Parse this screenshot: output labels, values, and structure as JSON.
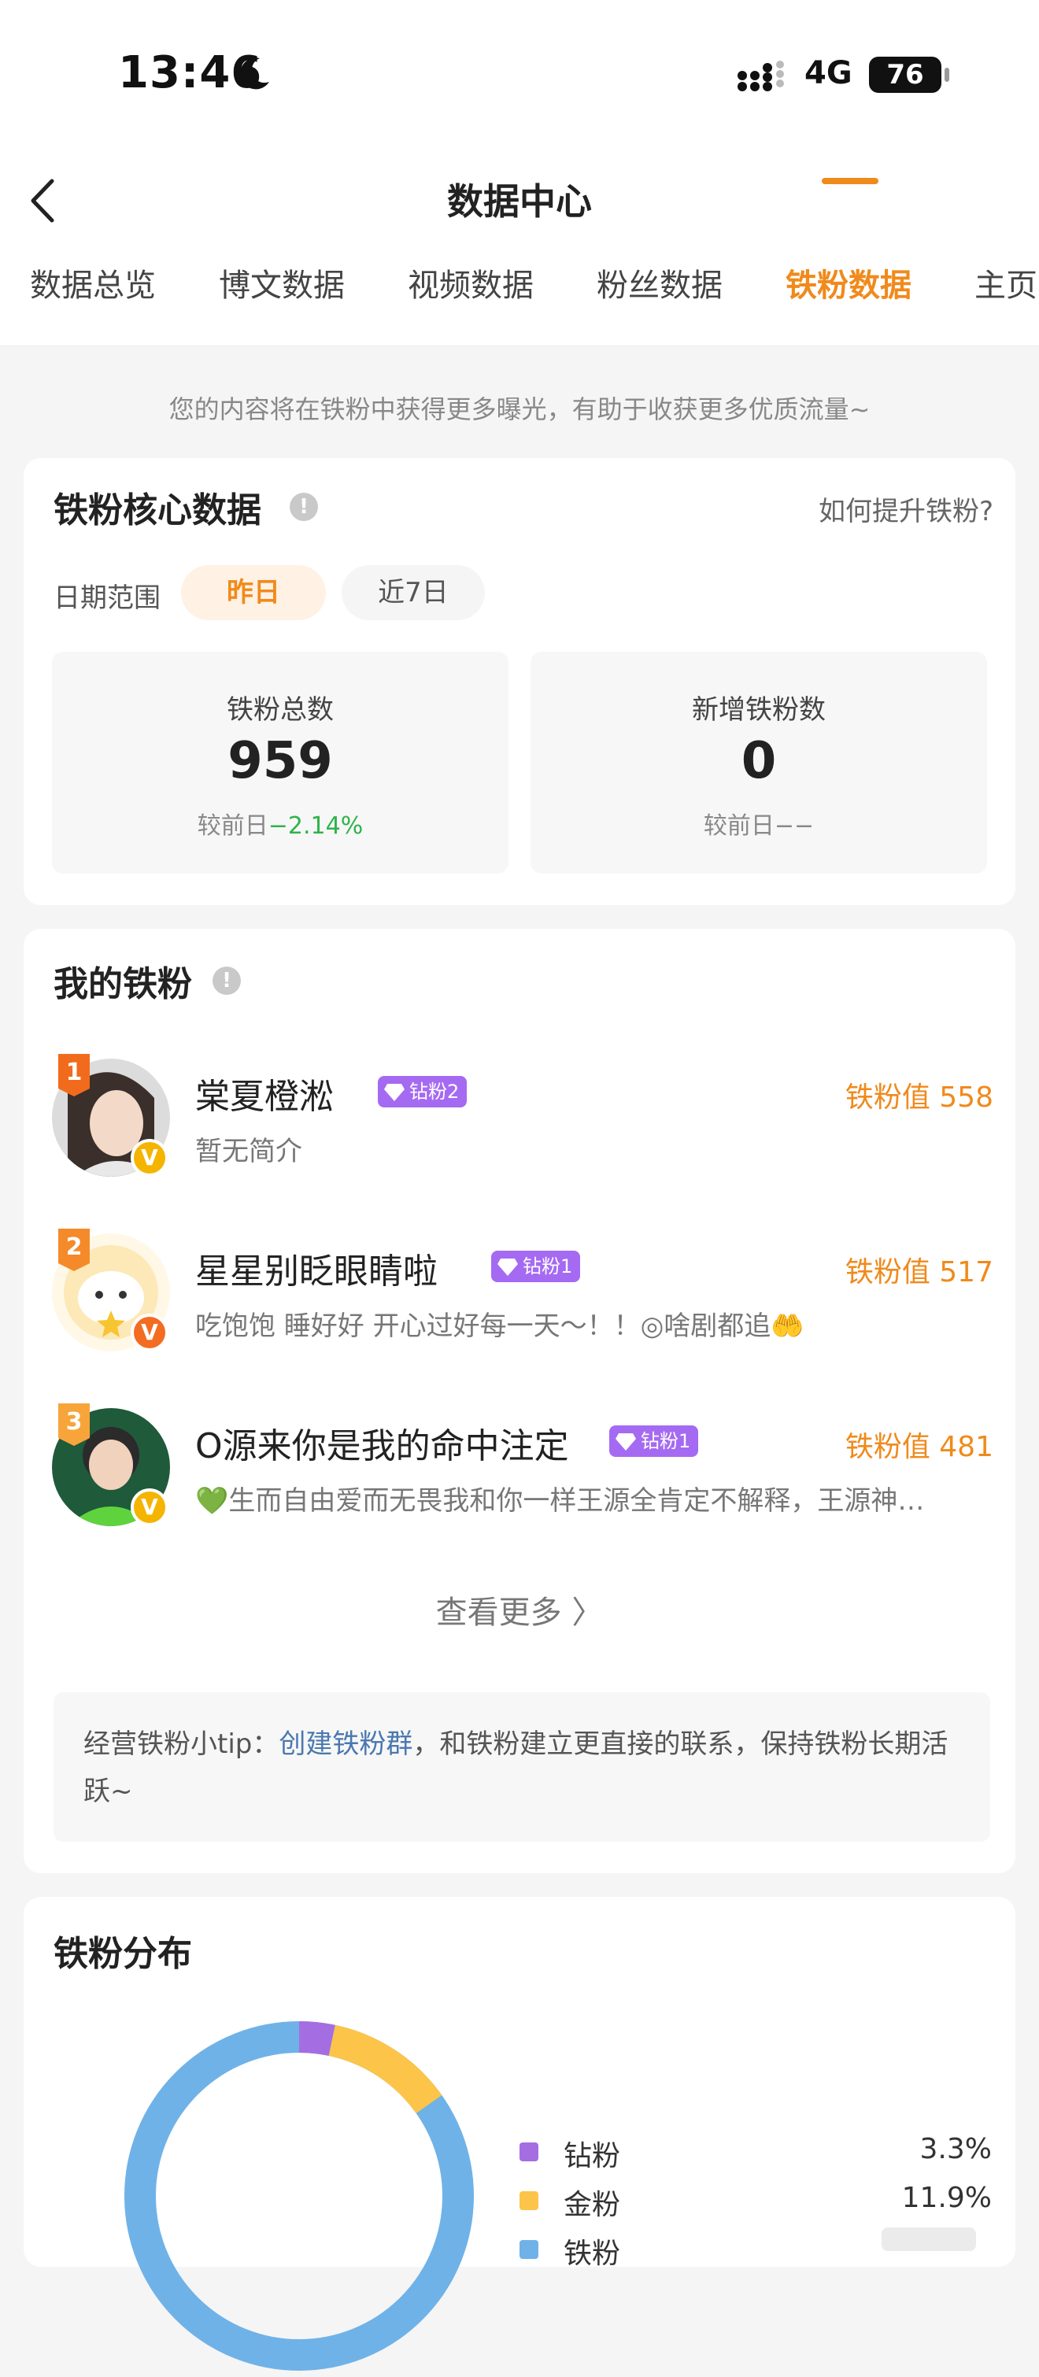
{
  "status_bar": {
    "time": "13:46",
    "network": "4G",
    "battery": "76"
  },
  "nav": {
    "title": "数据中心",
    "tabs": [
      {
        "label": "数据总览",
        "active": false
      },
      {
        "label": "博文数据",
        "active": false
      },
      {
        "label": "视频数据",
        "active": false
      },
      {
        "label": "粉丝数据",
        "active": false
      },
      {
        "label": "铁粉数据",
        "active": true
      },
      {
        "label": "主页",
        "active": false
      }
    ]
  },
  "notice": "您的内容将在铁粉中获得更多曝光，有助于收获更多优质流量~",
  "core": {
    "title": "铁粉核心数据",
    "how_link": "如何提升铁粉?",
    "range_label": "日期范围",
    "ranges": [
      "昨日",
      "近7日"
    ],
    "stats": [
      {
        "label": "铁粉总数",
        "value": "959",
        "compare_prefix": "较前日",
        "compare_value": "−2.14%"
      },
      {
        "label": "新增铁粉数",
        "value": "0",
        "compare_prefix": "较前日",
        "compare_value": "−−"
      }
    ]
  },
  "fans": {
    "title": "我的铁粉",
    "list": [
      {
        "rank": "1",
        "name": "棠夏橙淞",
        "level": "钻粉2",
        "value": "铁粉值 558",
        "bio": "暂无简介"
      },
      {
        "rank": "2",
        "name": "星星别眨眼睛啦",
        "level": "钻粉1",
        "value": "铁粉值 517",
        "bio": "吃饱饱 睡好好 开心过好每一天～！！◎啥剧都追🤲"
      },
      {
        "rank": "3",
        "name": "O源来你是我的命中注定",
        "level": "钻粉1",
        "value": "铁粉值 481",
        "bio": "💚生而自由爱而无畏我和你一样王源全肯定不解释，王源神…"
      }
    ],
    "more": "查看更多 〉",
    "tip_prefix": "经营铁粉小tip：",
    "tip_link": "创建铁粉群",
    "tip_suffix": "，和铁粉建立更直接的联系，保持铁粉长期活跃~"
  },
  "distribution": {
    "title": "铁粉分布",
    "legend": [
      {
        "name": "钻粉",
        "pct": "3.3%",
        "color": "#a56de2"
      },
      {
        "name": "金粉",
        "pct": "11.9%",
        "color": "#fcc449"
      },
      {
        "name": "铁粉",
        "pct": "",
        "color": "#6fb2e8"
      }
    ]
  },
  "colors": {
    "accent": "#f08a1c",
    "down": "#2fb34a",
    "link": "#4a78b0"
  }
}
